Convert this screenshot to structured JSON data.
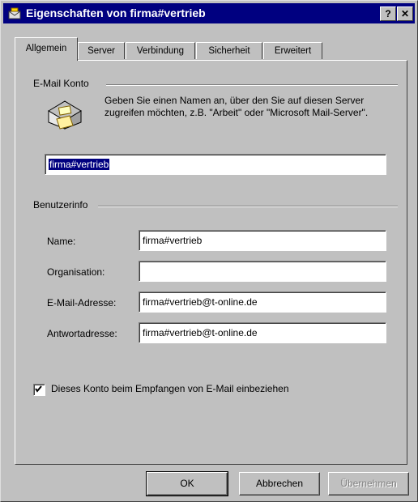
{
  "window": {
    "title": "Eigenschaften von firma#vertrieb",
    "help_label": "?",
    "close_label": "✕"
  },
  "tabs": [
    {
      "label": "Allgemein",
      "active": true
    },
    {
      "label": "Server"
    },
    {
      "label": "Verbindung"
    },
    {
      "label": "Sicherheit"
    },
    {
      "label": "Erweitert"
    }
  ],
  "email_konto": {
    "group_label": "E-Mail Konto",
    "description": "Geben Sie einen Namen an, über den Sie auf diesen Server zugreifen möchten, z.B. \"Arbeit\" oder \"Microsoft Mail-Server\".",
    "account_name": "firma#vertrieb"
  },
  "benutzerinfo": {
    "group_label": "Benutzerinfo",
    "fields": [
      {
        "label": "Name:",
        "value": "firma#vertrieb"
      },
      {
        "label": "Organisation:",
        "value": ""
      },
      {
        "label": "E-Mail-Adresse:",
        "value": "firma#vertrieb@t-online.de"
      },
      {
        "label": "Antwortadresse:",
        "value": "firma#vertrieb@t-online.de"
      }
    ]
  },
  "include_checkbox": {
    "label": "Dieses Konto beim Empfangen von E-Mail einbeziehen",
    "checked": true
  },
  "buttons": {
    "ok": "OK",
    "cancel": "Abbrechen",
    "apply": "Übernehmen"
  }
}
